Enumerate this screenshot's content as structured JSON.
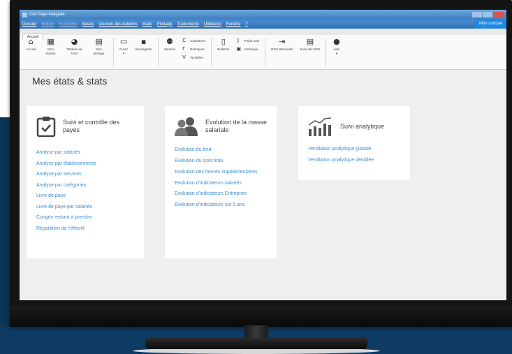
{
  "window": {
    "title": "Ciel Paye Intégrale"
  },
  "menu": {
    "items": [
      {
        "label": "Dossier",
        "dim": false
      },
      {
        "label": "Edition",
        "dim": true
      },
      {
        "label": "Fonctions",
        "dim": true
      },
      {
        "label": "Bases",
        "dim": false
      },
      {
        "label": "Gestion des bulletins",
        "dim": false
      },
      {
        "label": "Etats",
        "dim": false
      },
      {
        "label": "Pilotage",
        "dim": false
      },
      {
        "label": "Traitements",
        "dim": false
      },
      {
        "label": "Utilitaires",
        "dim": false
      },
      {
        "label": "Fenêtre",
        "dim": false
      },
      {
        "label": "?",
        "dim": false
      }
    ],
    "account_label": "Mon compte"
  },
  "tabs": {
    "active": "Accueil"
  },
  "ribbon": {
    "accueil": "Accueil",
    "mon_bureau": "Mon bureau",
    "tableau_de_bord": "Tableau de bord",
    "mon_pilotage": "Mon pilotage",
    "ouvrir": "Ouvrir",
    "sauvegarde": "Sauvegarde",
    "salaries": "Salariés",
    "cotisations": "Cotisations",
    "rubriques": "Rubriques",
    "variables": "Variables",
    "bulletins": "Bulletins",
    "prepa_paie": "Prépa paie",
    "historique": "Historique",
    "dsn_mensuelle": "DSN Mensuelle",
    "suivi_dsn": "Suivi des DSN",
    "aide": "Aide"
  },
  "page": {
    "title": "Mes états & stats"
  },
  "cards": [
    {
      "title": "Suivi et contrôle des payes",
      "icon": "clipboard-check-icon",
      "links": [
        "Analyse par salariés",
        "Analyse par établissements",
        "Analyse par services",
        "Analyse par catégories",
        "Livre de paye",
        "Livre de paye par salariés",
        "Congés restant à prendre",
        "Répartition de l'effectif"
      ]
    },
    {
      "title": "Evolution de la masse salariale",
      "icon": "people-icon",
      "links": [
        "Evolution du brut",
        "Evolution du coût total",
        "Evolution des heures supplémentaires",
        "Evolution d'indicateurs salariés",
        "Evolution d'indicateurs Entreprise",
        "Evolution d'indicateurs sur 5 ans"
      ]
    },
    {
      "title": "Suivi analytique",
      "icon": "bar-chart-trend-icon",
      "links": [
        "Ventilation analytique globale",
        "Ventilation analytique détaillée"
      ]
    }
  ],
  "colors": {
    "link": "#3b8fd6",
    "titlebar": "#3c7dc0",
    "account_button": "#1e88e5",
    "background_navy": "#0e3b63"
  }
}
